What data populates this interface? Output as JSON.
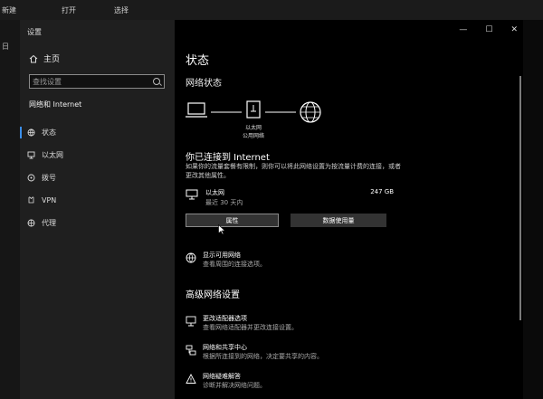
{
  "background": {
    "top_labels": [
      "新建",
      "打开",
      "选择"
    ],
    "left_label": "日"
  },
  "window": {
    "title": "设置",
    "controls": {
      "minimize": "—",
      "maximize": "☐",
      "close": "✕"
    }
  },
  "sidebar": {
    "home_label": "主页",
    "search_placeholder": "查找设置",
    "section_heading": "网络和 Internet",
    "items": [
      {
        "label": "状态",
        "active": true,
        "icon": "status-icon"
      },
      {
        "label": "以太网",
        "active": false,
        "icon": "ethernet-icon"
      },
      {
        "label": "拨号",
        "active": false,
        "icon": "dialup-icon"
      },
      {
        "label": "VPN",
        "active": false,
        "icon": "vpn-icon"
      },
      {
        "label": "代理",
        "active": false,
        "icon": "proxy-icon"
      }
    ]
  },
  "main": {
    "page_title": "状态",
    "network_status_heading": "网络状态",
    "diagram_label_line1": "以太网",
    "diagram_label_line2": "公用网络",
    "connected_heading": "你已连接到 Internet",
    "connected_description": "如果你的流量套餐有限制，则你可以将此网络设置为按流量计费的连接，或者更改其他属性。",
    "adapter": {
      "name": "以太网",
      "period": "最近 30 天内",
      "usage": "247 GB"
    },
    "properties_button": "属性",
    "data_usage_button": "数据使用量",
    "show_networks": {
      "title": "显示可用网络",
      "description": "查看周围的连接选项。"
    },
    "advanced_heading": "高级网络设置",
    "advanced_options": [
      {
        "title": "更改适配器选项",
        "description": "查看网络适配器并更改连接设置。"
      },
      {
        "title": "网络和共享中心",
        "description": "根据所连接到的网络，决定要共享的内容。"
      },
      {
        "title": "网络疑难解答",
        "description": "诊断并解决网络问题。"
      }
    ]
  },
  "colors": {
    "accent": "#3b8eea",
    "sidebar_bg": "#1f1f1f",
    "content_bg": "#000000"
  }
}
